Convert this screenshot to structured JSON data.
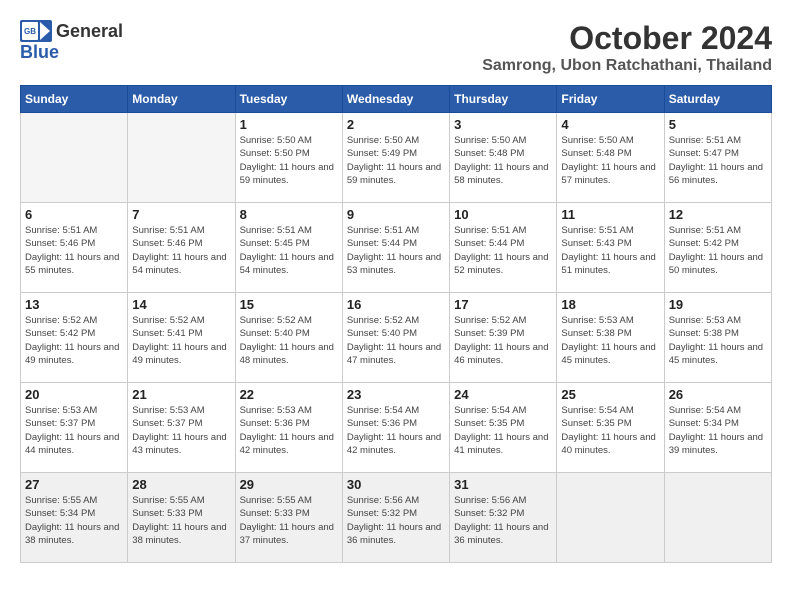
{
  "header": {
    "logo_general": "General",
    "logo_blue": "Blue",
    "month": "October 2024",
    "location": "Samrong, Ubon Ratchathani, Thailand"
  },
  "days_of_week": [
    "Sunday",
    "Monday",
    "Tuesday",
    "Wednesday",
    "Thursday",
    "Friday",
    "Saturday"
  ],
  "weeks": [
    [
      {
        "day": "",
        "empty": true
      },
      {
        "day": "",
        "empty": true
      },
      {
        "day": "1",
        "sunrise": "5:50 AM",
        "sunset": "5:50 PM",
        "daylight": "11 hours and 59 minutes."
      },
      {
        "day": "2",
        "sunrise": "5:50 AM",
        "sunset": "5:49 PM",
        "daylight": "11 hours and 59 minutes."
      },
      {
        "day": "3",
        "sunrise": "5:50 AM",
        "sunset": "5:48 PM",
        "daylight": "11 hours and 58 minutes."
      },
      {
        "day": "4",
        "sunrise": "5:50 AM",
        "sunset": "5:48 PM",
        "daylight": "11 hours and 57 minutes."
      },
      {
        "day": "5",
        "sunrise": "5:51 AM",
        "sunset": "5:47 PM",
        "daylight": "11 hours and 56 minutes."
      }
    ],
    [
      {
        "day": "6",
        "sunrise": "5:51 AM",
        "sunset": "5:46 PM",
        "daylight": "11 hours and 55 minutes."
      },
      {
        "day": "7",
        "sunrise": "5:51 AM",
        "sunset": "5:46 PM",
        "daylight": "11 hours and 54 minutes."
      },
      {
        "day": "8",
        "sunrise": "5:51 AM",
        "sunset": "5:45 PM",
        "daylight": "11 hours and 54 minutes."
      },
      {
        "day": "9",
        "sunrise": "5:51 AM",
        "sunset": "5:44 PM",
        "daylight": "11 hours and 53 minutes."
      },
      {
        "day": "10",
        "sunrise": "5:51 AM",
        "sunset": "5:44 PM",
        "daylight": "11 hours and 52 minutes."
      },
      {
        "day": "11",
        "sunrise": "5:51 AM",
        "sunset": "5:43 PM",
        "daylight": "11 hours and 51 minutes."
      },
      {
        "day": "12",
        "sunrise": "5:51 AM",
        "sunset": "5:42 PM",
        "daylight": "11 hours and 50 minutes."
      }
    ],
    [
      {
        "day": "13",
        "sunrise": "5:52 AM",
        "sunset": "5:42 PM",
        "daylight": "11 hours and 49 minutes."
      },
      {
        "day": "14",
        "sunrise": "5:52 AM",
        "sunset": "5:41 PM",
        "daylight": "11 hours and 49 minutes."
      },
      {
        "day": "15",
        "sunrise": "5:52 AM",
        "sunset": "5:40 PM",
        "daylight": "11 hours and 48 minutes."
      },
      {
        "day": "16",
        "sunrise": "5:52 AM",
        "sunset": "5:40 PM",
        "daylight": "11 hours and 47 minutes."
      },
      {
        "day": "17",
        "sunrise": "5:52 AM",
        "sunset": "5:39 PM",
        "daylight": "11 hours and 46 minutes."
      },
      {
        "day": "18",
        "sunrise": "5:53 AM",
        "sunset": "5:38 PM",
        "daylight": "11 hours and 45 minutes."
      },
      {
        "day": "19",
        "sunrise": "5:53 AM",
        "sunset": "5:38 PM",
        "daylight": "11 hours and 45 minutes."
      }
    ],
    [
      {
        "day": "20",
        "sunrise": "5:53 AM",
        "sunset": "5:37 PM",
        "daylight": "11 hours and 44 minutes."
      },
      {
        "day": "21",
        "sunrise": "5:53 AM",
        "sunset": "5:37 PM",
        "daylight": "11 hours and 43 minutes."
      },
      {
        "day": "22",
        "sunrise": "5:53 AM",
        "sunset": "5:36 PM",
        "daylight": "11 hours and 42 minutes."
      },
      {
        "day": "23",
        "sunrise": "5:54 AM",
        "sunset": "5:36 PM",
        "daylight": "11 hours and 42 minutes."
      },
      {
        "day": "24",
        "sunrise": "5:54 AM",
        "sunset": "5:35 PM",
        "daylight": "11 hours and 41 minutes."
      },
      {
        "day": "25",
        "sunrise": "5:54 AM",
        "sunset": "5:35 PM",
        "daylight": "11 hours and 40 minutes."
      },
      {
        "day": "26",
        "sunrise": "5:54 AM",
        "sunset": "5:34 PM",
        "daylight": "11 hours and 39 minutes."
      }
    ],
    [
      {
        "day": "27",
        "sunrise": "5:55 AM",
        "sunset": "5:34 PM",
        "daylight": "11 hours and 38 minutes."
      },
      {
        "day": "28",
        "sunrise": "5:55 AM",
        "sunset": "5:33 PM",
        "daylight": "11 hours and 38 minutes."
      },
      {
        "day": "29",
        "sunrise": "5:55 AM",
        "sunset": "5:33 PM",
        "daylight": "11 hours and 37 minutes."
      },
      {
        "day": "30",
        "sunrise": "5:56 AM",
        "sunset": "5:32 PM",
        "daylight": "11 hours and 36 minutes."
      },
      {
        "day": "31",
        "sunrise": "5:56 AM",
        "sunset": "5:32 PM",
        "daylight": "11 hours and 36 minutes."
      },
      {
        "day": "",
        "empty": true,
        "last": true
      },
      {
        "day": "",
        "empty": true,
        "last": true
      }
    ]
  ]
}
